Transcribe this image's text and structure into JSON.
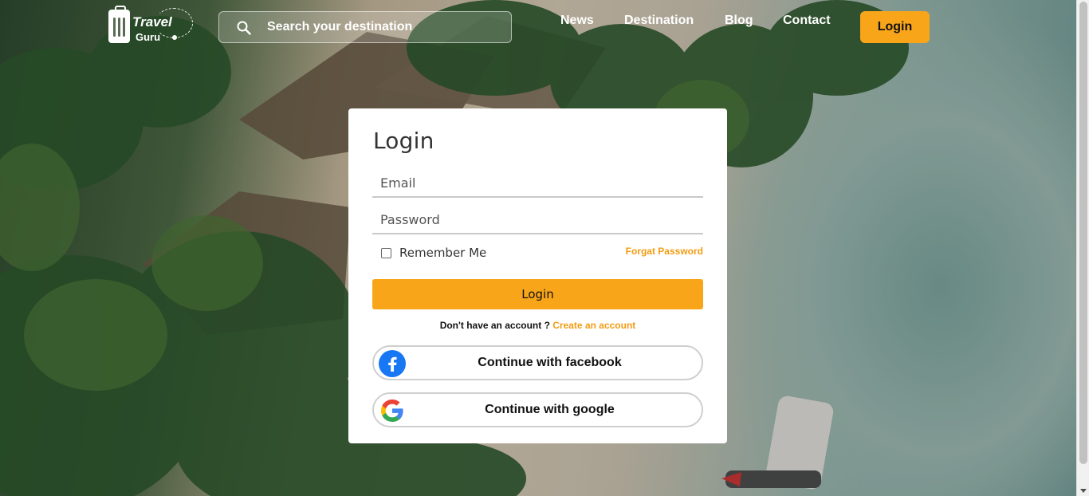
{
  "header": {
    "logo": {
      "line1": "Travel",
      "line2": "Guru"
    },
    "search": {
      "placeholder": "Search your destination",
      "icon": "search-icon"
    },
    "nav": [
      {
        "label": "News"
      },
      {
        "label": "Destination"
      },
      {
        "label": "Blog"
      },
      {
        "label": "Contact"
      }
    ],
    "login_label": "Login"
  },
  "login_form": {
    "title": "Login",
    "email_placeholder": "Email",
    "password_placeholder": "Password",
    "remember_label": "Remember Me",
    "forgot_label": "Forgat Password",
    "submit_label": "Login",
    "signup_prompt": "Don't have an account ?",
    "signup_link": "Create an account",
    "facebook_label": "Continue with facebook",
    "google_label": "Continue with google"
  },
  "colors": {
    "accent": "#f9a51a",
    "link": "#f39c12",
    "facebook": "#1877f2"
  }
}
